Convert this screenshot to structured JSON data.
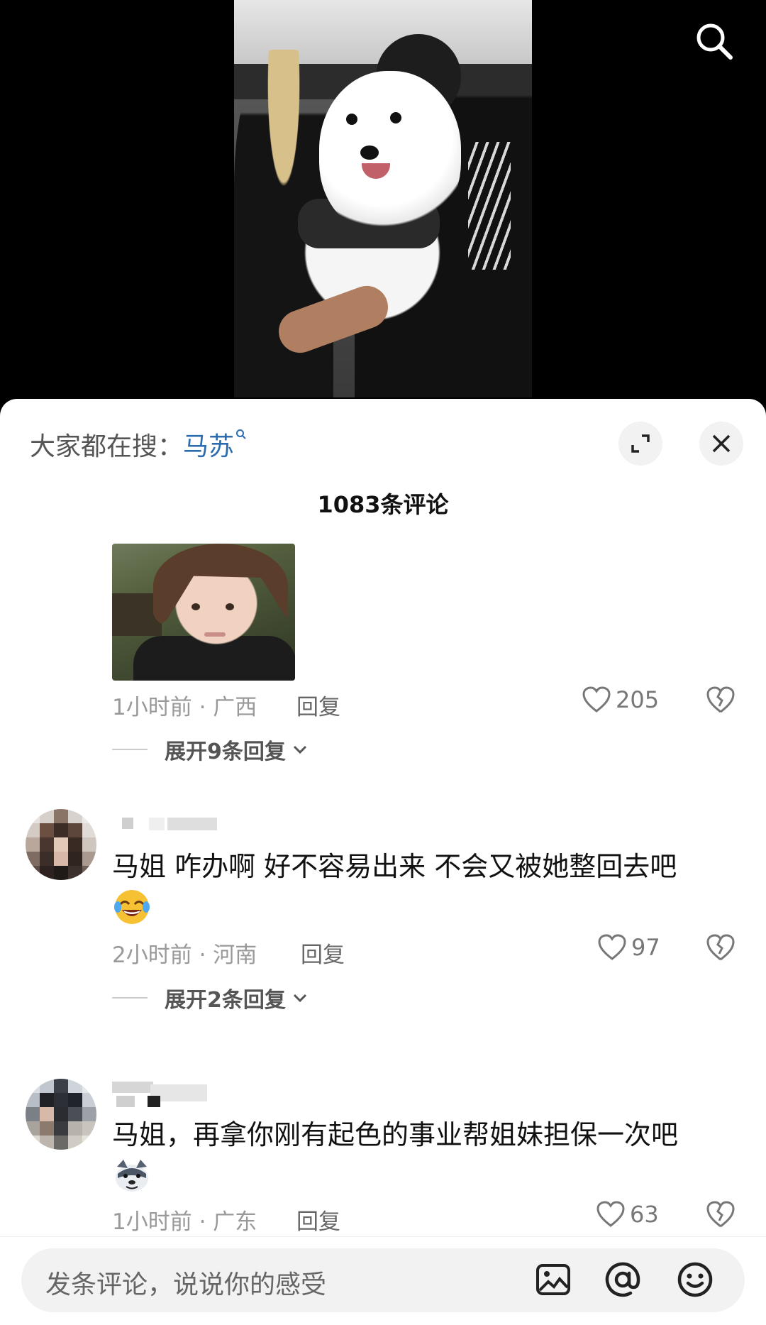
{
  "header": {
    "search_icon": "search-icon"
  },
  "sheet": {
    "hot_search_label": "大家都在搜：",
    "hot_search_keyword": "马苏",
    "comment_count_title": "1083条评论"
  },
  "comments": [
    {
      "meta": "1小时前 · 广西",
      "reply_label": "回复",
      "likes": "205",
      "expand_label": "展开9条回复"
    },
    {
      "text": "马姐  咋办啊  好不容易出来  不会又被她整回去吧",
      "meta": "2小时前 · 河南",
      "reply_label": "回复",
      "likes": "97",
      "expand_label": "展开2条回复"
    },
    {
      "text": "马姐，再拿你刚有起色的事业帮姐妹担保一次吧",
      "meta": "1小时前 · 广东",
      "reply_label": "回复",
      "likes": "63"
    }
  ],
  "input": {
    "placeholder": "发条评论，说说你的感受"
  },
  "colors": {
    "keyword": "#2b6cb0",
    "meta": "#999999",
    "background": "#ffffff"
  }
}
